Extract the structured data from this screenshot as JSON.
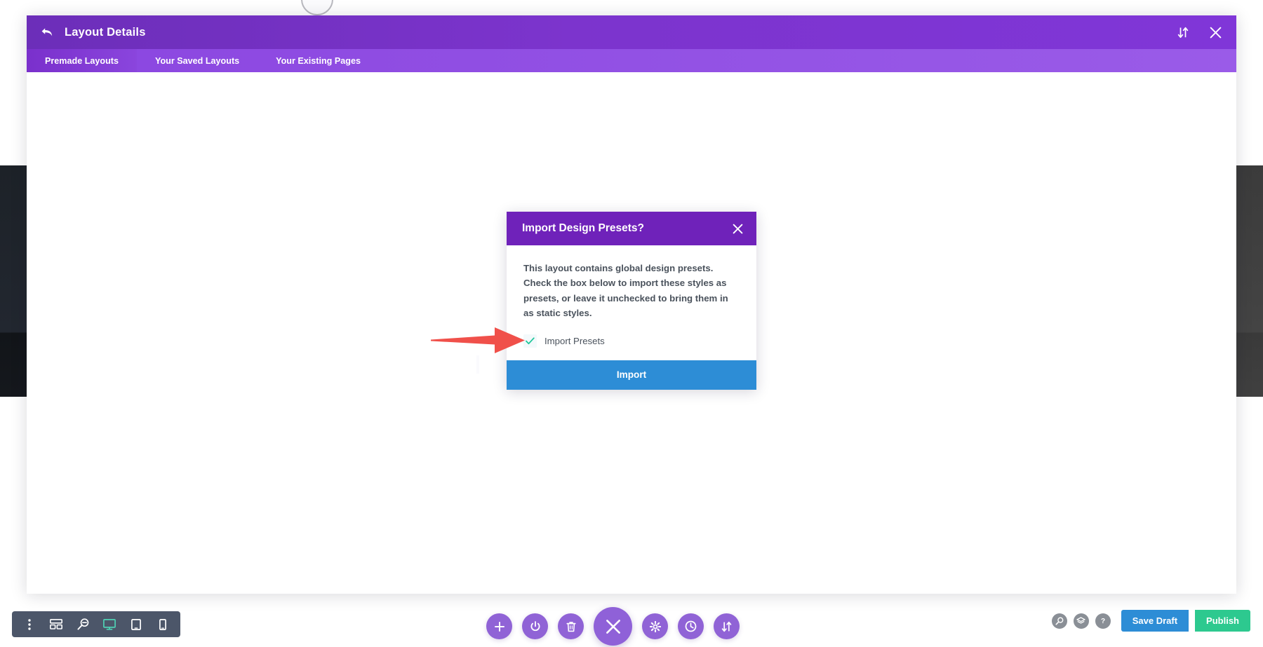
{
  "panel": {
    "title": "Layout Details",
    "back_icon": "back-arrow-icon",
    "header_icons": [
      {
        "name": "sort-updown-icon",
        "glyph": "⇅"
      },
      {
        "name": "close-icon",
        "glyph": "✕"
      }
    ],
    "tabs": [
      {
        "label": "Premade Layouts",
        "active": true
      },
      {
        "label": "Your Saved Layouts",
        "active": false
      },
      {
        "label": "Your Existing Pages",
        "active": false
      }
    ]
  },
  "modal": {
    "title": "Import Design Presets?",
    "close_icon": "close-icon",
    "body_text": "This layout contains global design presets. Check the box below to import these styles as presets, or leave it unchecked to bring them in as static styles.",
    "checkbox": {
      "label": "Import Presets",
      "checked": true,
      "check_color": "#1fc79a"
    },
    "import_button_label": "Import",
    "import_button_color": "#2d8dd6",
    "header_color": "#6f22ba"
  },
  "annotation": {
    "arrow_color": "#f0504a",
    "points_to": "import-presets-checkbox"
  },
  "device_toolbar": {
    "items": [
      {
        "name": "more-options-icon",
        "label": "",
        "active": false
      },
      {
        "name": "wireframe-icon",
        "label": "",
        "active": false
      },
      {
        "name": "zoom-out-icon",
        "label": "",
        "active": false
      },
      {
        "name": "desktop-icon",
        "label": "",
        "active": true
      },
      {
        "name": "tablet-icon",
        "label": "",
        "active": false
      },
      {
        "name": "phone-icon",
        "label": "",
        "active": false
      }
    ]
  },
  "center_toolbar": {
    "items": [
      {
        "name": "add-icon",
        "glyph": "+",
        "main": false
      },
      {
        "name": "power-icon",
        "glyph": "⏻",
        "main": false
      },
      {
        "name": "trash-icon",
        "glyph": "🗑",
        "main": false
      },
      {
        "name": "close-icon",
        "glyph": "✕",
        "main": true
      },
      {
        "name": "settings-gear-icon",
        "glyph": "⚙",
        "main": false
      },
      {
        "name": "history-clock-icon",
        "glyph": "◴",
        "main": false
      },
      {
        "name": "sort-updown-icon",
        "glyph": "⇅",
        "main": false
      }
    ]
  },
  "bottom_right": {
    "icons": [
      {
        "name": "search-icon",
        "glyph": "⚲"
      },
      {
        "name": "layers-icon",
        "glyph": "≣"
      },
      {
        "name": "help-icon",
        "glyph": "?"
      }
    ],
    "save_draft_label": "Save Draft",
    "publish_label": "Publish",
    "save_draft_color": "#2d8dd6",
    "publish_color": "#2dc98f"
  }
}
